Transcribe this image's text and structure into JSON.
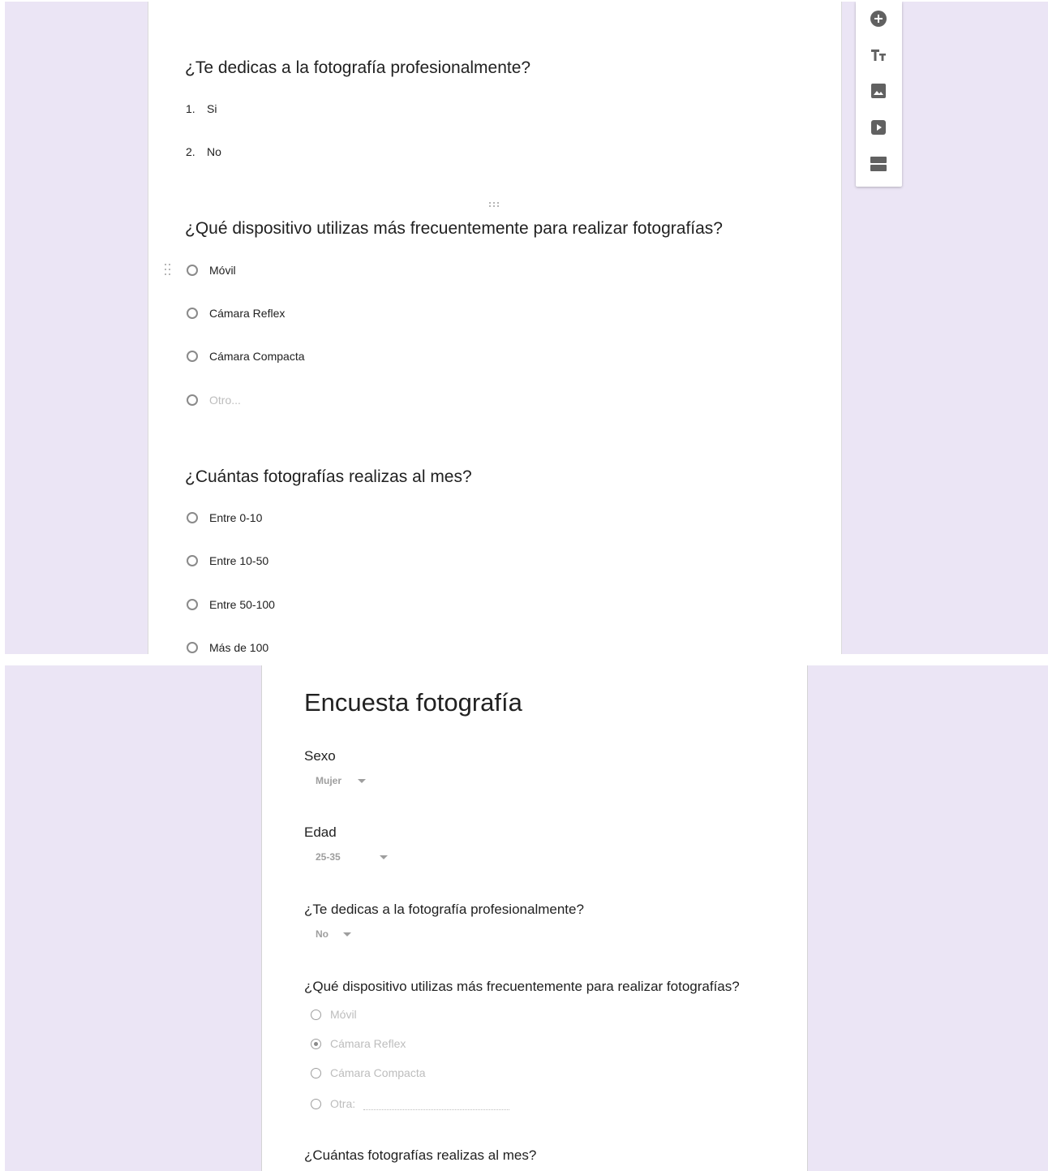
{
  "editor": {
    "questions": [
      {
        "title": "¿Te dedicas a la fotografía profesionalmente?",
        "type": "list",
        "items": [
          {
            "num": "1.",
            "label": "Si"
          },
          {
            "num": "2.",
            "label": "No"
          }
        ]
      },
      {
        "title": "¿Qué dispositivo utilizas más frecuentemente para realizar fotografías?",
        "type": "multiple-choice",
        "options": [
          "Móvil",
          "Cámara Reflex",
          "Cámara Compacta"
        ],
        "other_placeholder": "Otro..."
      },
      {
        "title": "¿Cuántas fotografías realizas al mes?",
        "type": "multiple-choice",
        "options": [
          "Entre 0-10",
          "Entre 10-50",
          "Entre 50-100",
          "Más de 100"
        ]
      }
    ],
    "toolbar": [
      "add-question-icon",
      "add-title-icon",
      "add-image-icon",
      "add-video-icon",
      "add-section-icon"
    ]
  },
  "preview": {
    "form_title": "Encuesta fotografía",
    "questions": [
      {
        "label": "Sexo",
        "type": "dropdown",
        "value": "Mujer"
      },
      {
        "label": "Edad",
        "type": "dropdown",
        "value": "25-35"
      },
      {
        "label": "¿Te dedicas a la fotografía profesionalmente?",
        "type": "dropdown",
        "value": "No"
      },
      {
        "label": "¿Qué dispositivo utilizas más frecuentemente para realizar fotografías?",
        "type": "radio",
        "options": [
          "Móvil",
          "Cámara Reflex",
          "Cámara Compacta"
        ],
        "selected": "Cámara Reflex",
        "other_label": "Otra:"
      },
      {
        "label": "¿Cuántas fotografías realizas al mes?",
        "type": "radio"
      }
    ]
  },
  "colors": {
    "page_background": "#ebe5f5",
    "card": "#ffffff",
    "text": "#212121",
    "muted_text": "#9e9e9e",
    "toolbar_icon": "#616161"
  }
}
